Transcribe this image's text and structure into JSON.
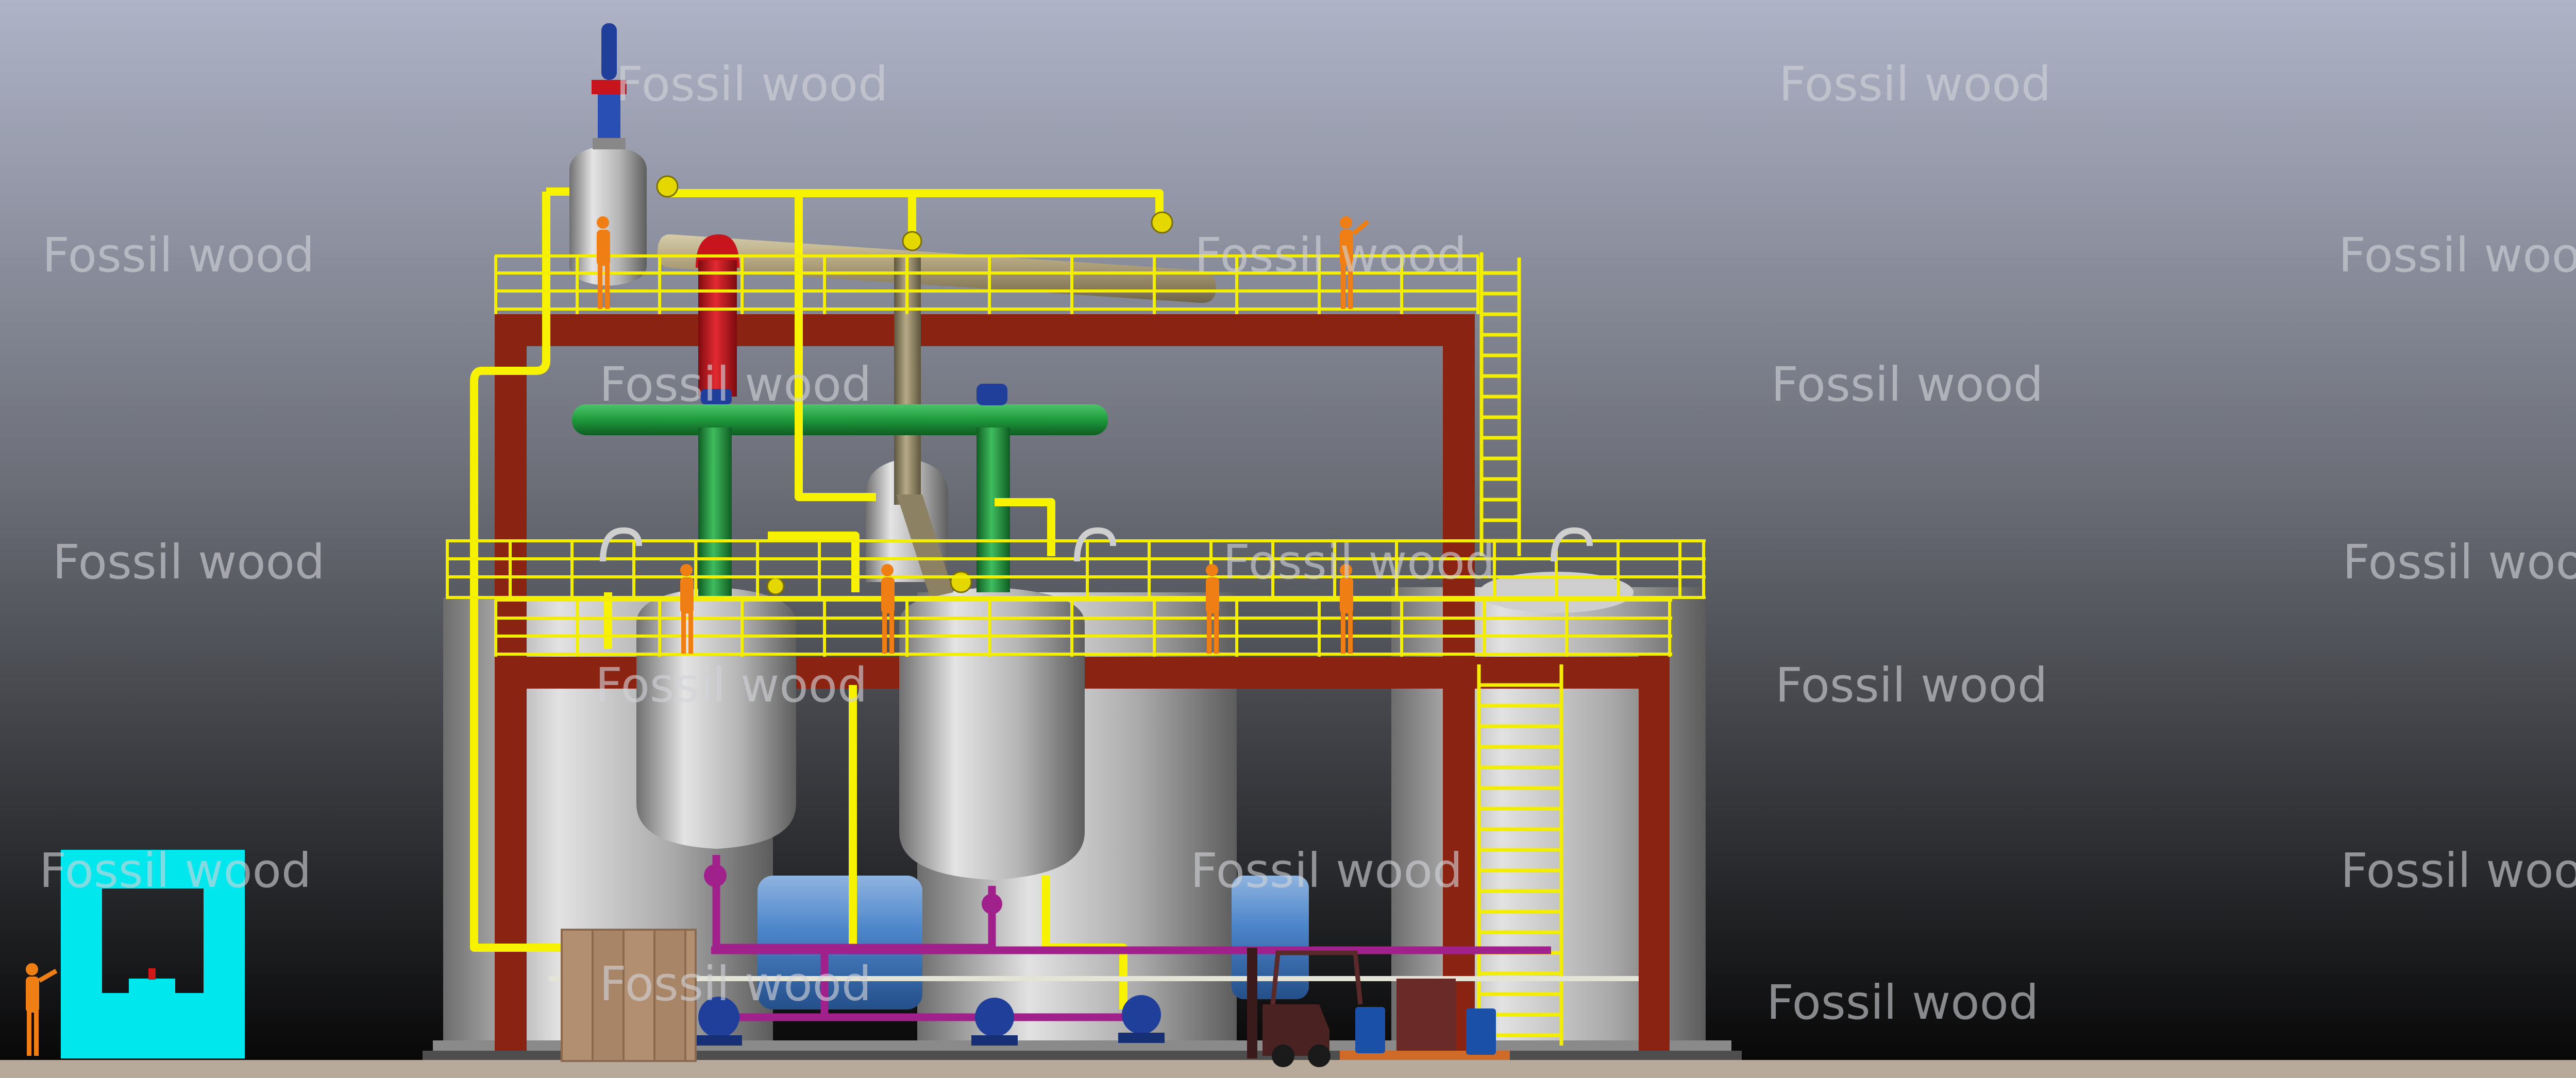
{
  "watermark": {
    "text": "Fossil wood",
    "color": "#d2d4d8"
  },
  "colors": {
    "background_top": "#aeb3c7",
    "background_bottom": "#050505",
    "ground": "#b8aa9a",
    "steel_frame": "#8b2313",
    "railing": "#f3ee00",
    "process_pipe": "#f6f200",
    "green_manifold": "#1e9a3c",
    "red_riser": "#c8141c",
    "purple_pipe": "#a0208c",
    "worker": "#ef7f14",
    "control_cabin": "#00e8ee",
    "tank_steel": "#b8b8b8",
    "condenser_khaki": "#b6aa86",
    "motor_blue": "#1f3f9a"
  },
  "icons": [
    "worker-icon",
    "forklift-icon",
    "pump-icon",
    "valve-icon",
    "drum-icon",
    "motor-icon",
    "crate-icon"
  ]
}
